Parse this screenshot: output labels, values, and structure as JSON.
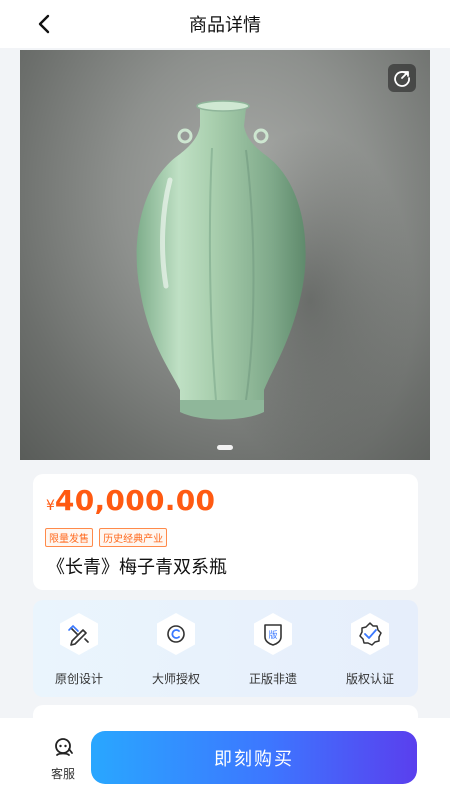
{
  "header": {
    "title": "商品详情"
  },
  "gallery": {
    "total_images": 1,
    "current_index": 1
  },
  "product": {
    "currency_symbol": "¥",
    "price": "40,000.00",
    "tags": [
      "限量发售",
      "历史经典产业"
    ],
    "title": "《长青》梅子青双系瓶"
  },
  "features": [
    {
      "label": "原创设计",
      "icon": "pen-ruler-icon"
    },
    {
      "label": "大师授权",
      "icon": "copyright-icon"
    },
    {
      "label": "正版非遗",
      "icon": "shield-ban-icon",
      "icon_text": "版"
    },
    {
      "label": "版权认证",
      "icon": "badge-check-icon"
    }
  ],
  "bottom": {
    "service_label": "客服",
    "buy_label": "即刻购买"
  },
  "colors": {
    "price": "#ff5a12",
    "buy_gradient_start": "#29a7ff",
    "buy_gradient_end": "#5a3fee",
    "vase_celadon": "#a9cfae"
  }
}
